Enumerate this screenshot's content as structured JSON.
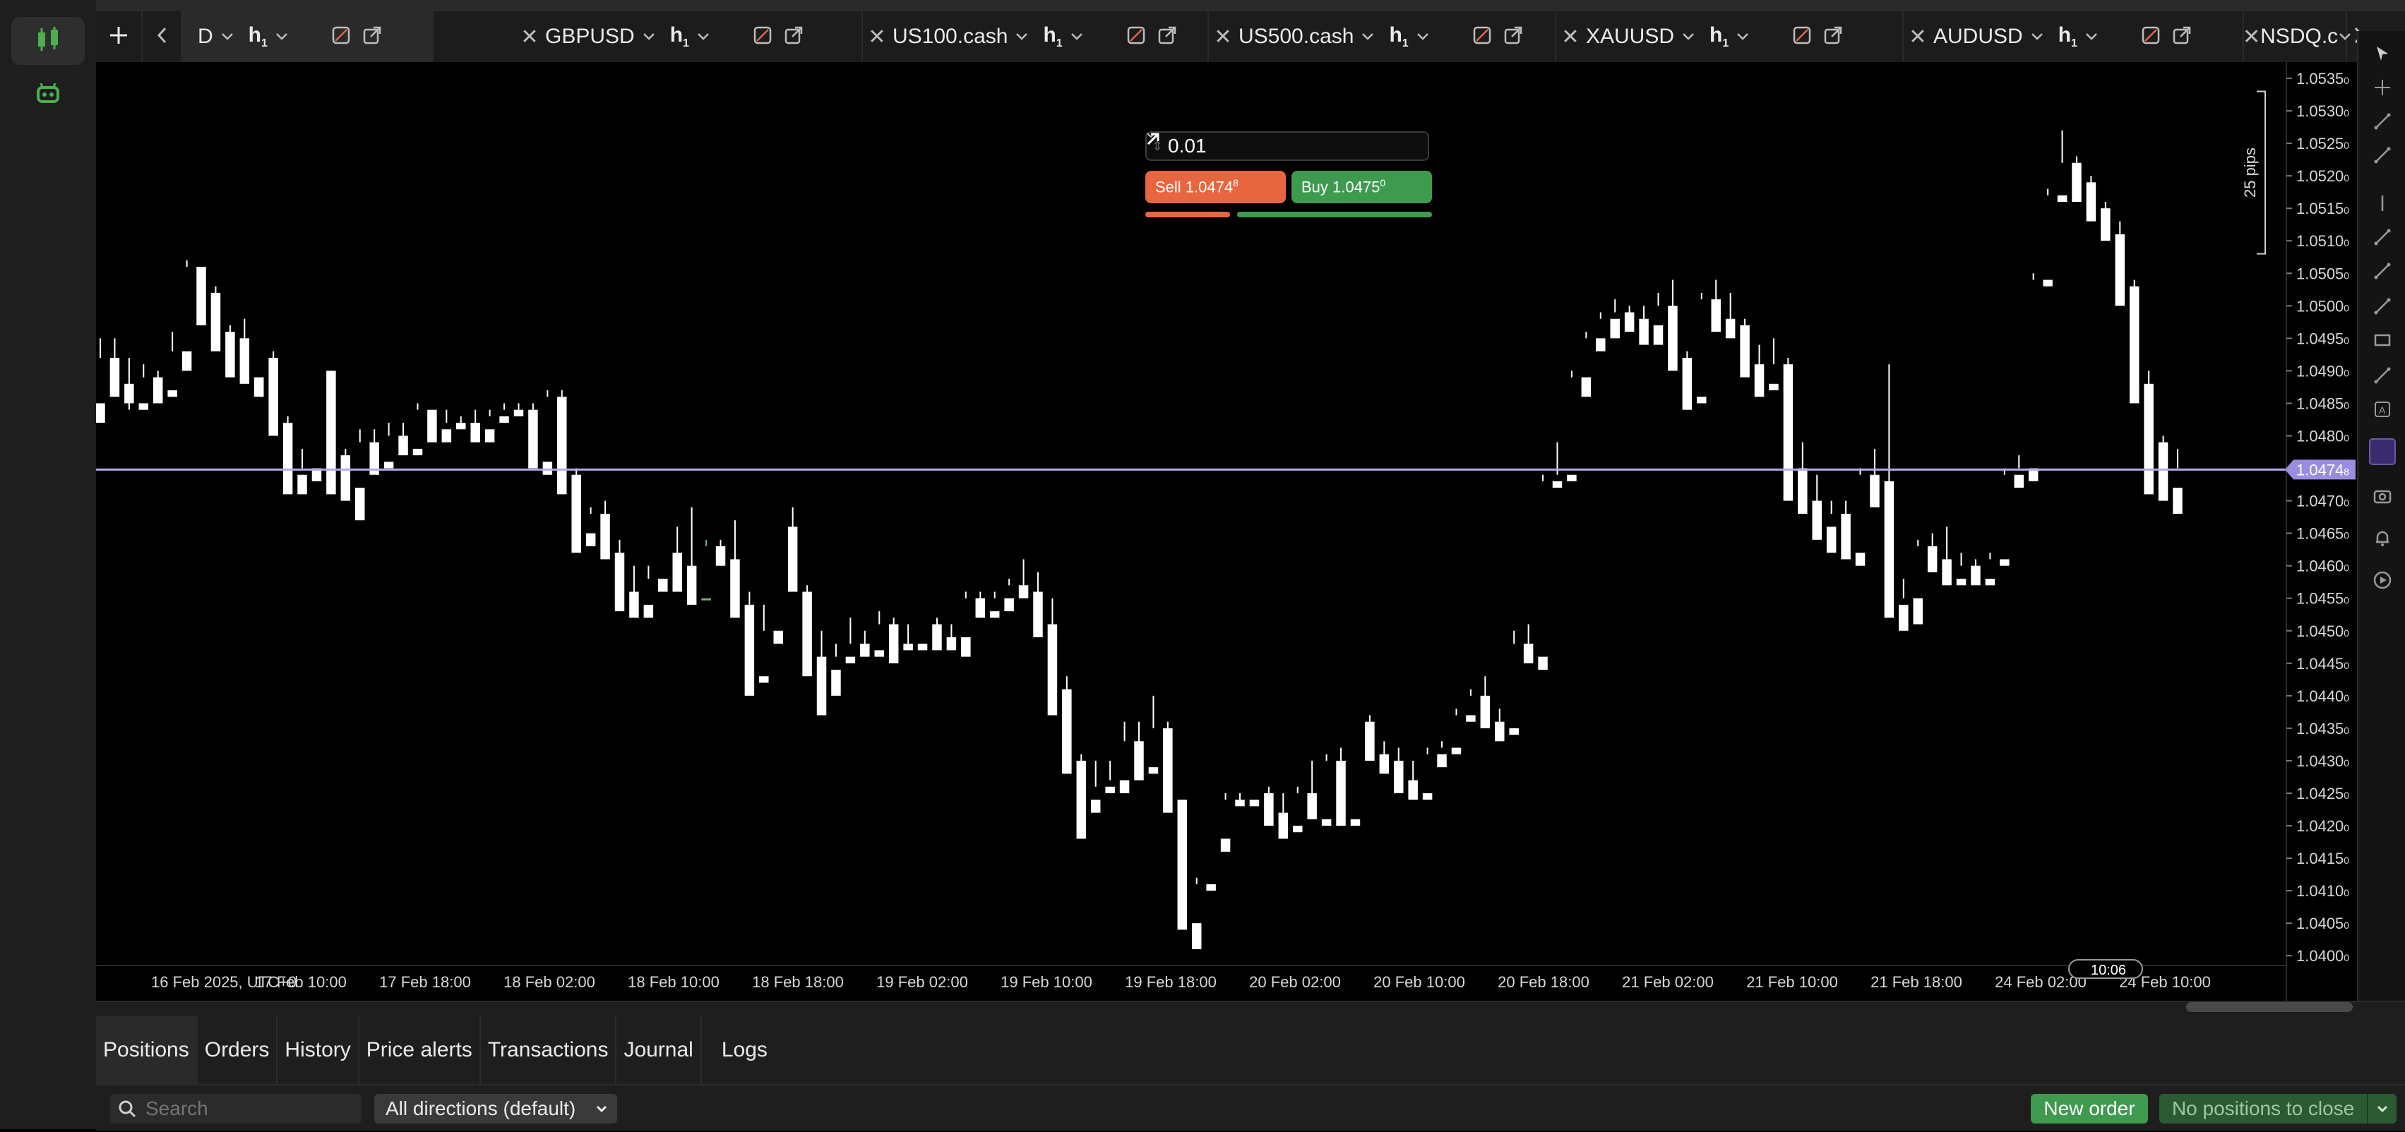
{
  "tabs": [
    {
      "symbol": "D",
      "timeframe": "h",
      "timeframe_sub": "1",
      "active": true
    },
    {
      "symbol": "GBPUSD",
      "timeframe": "h",
      "timeframe_sub": "1"
    },
    {
      "symbol": "US100.cash",
      "timeframe": "h",
      "timeframe_sub": "1"
    },
    {
      "symbol": "US500.cash",
      "timeframe": "h",
      "timeframe_sub": "1"
    },
    {
      "symbol": "XAUUSD",
      "timeframe": "h",
      "timeframe_sub": "1"
    },
    {
      "symbol": "AUDUSD",
      "timeframe": "h",
      "timeframe_sub": "1"
    },
    {
      "symbol": "NSDQ.c",
      "timeframe": "h",
      "timeframe_sub": "1"
    }
  ],
  "trade": {
    "lot": "0.01",
    "sell_label": "Sell 1.0474",
    "sell_small": "8",
    "buy_label": "Buy 1.0475",
    "buy_small": "0"
  },
  "chart_data": {
    "type": "candlestick",
    "x_ticks": [
      "16 Feb 2025, UTC+0",
      "17 Feb 10:00",
      "17 Feb 18:00",
      "18 Feb 02:00",
      "18 Feb 10:00",
      "18 Feb 18:00",
      "19 Feb 02:00",
      "19 Feb 10:00",
      "19 Feb 18:00",
      "20 Feb 02:00",
      "20 Feb 10:00",
      "20 Feb 18:00",
      "21 Feb 02:00",
      "21 Feb 10:00",
      "21 Feb 18:00",
      "24 Feb 02:00",
      "24 Feb 10:00"
    ],
    "y_ticks": [
      "1.0535",
      "1.0530",
      "1.0525",
      "1.0520",
      "1.0515",
      "1.0510",
      "1.0505",
      "1.0500",
      "1.0495",
      "1.0490",
      "1.0485",
      "1.0480",
      "1.0475",
      "1.0470",
      "1.0465",
      "1.0460",
      "1.0455",
      "1.0450",
      "1.0445",
      "1.0440",
      "1.0435",
      "1.0430",
      "1.0425",
      "1.0420",
      "1.0415",
      "1.0410",
      "1.0405",
      "1.0400"
    ],
    "y_tick_suffix": "0",
    "ylim": [
      1.03985,
      1.05375
    ],
    "current_price": "1.0474",
    "current_price_suffix": "8",
    "current_price_value": 1.04748,
    "crosshair_time": "10:06",
    "ruler_label": "25 pips",
    "ruler_range": [
      1.0508,
      1.0533
    ],
    "colors": {
      "up": "#6fb07c",
      "down": "#ffffff",
      "price_line": "#b7a9e6",
      "price_tag": "#9b8ce0"
    },
    "ohlc": [
      [
        1.0485,
        1.0495,
        1.0492,
        1.0482
      ],
      [
        1.0492,
        1.0495,
        1.0488,
        1.0486
      ],
      [
        1.0488,
        1.0492,
        1.0484,
        1.0485
      ],
      [
        1.0485,
        1.0491,
        1.0489,
        1.0484
      ],
      [
        1.0489,
        1.049,
        1.0487,
        1.0485
      ],
      [
        1.0487,
        1.0496,
        1.0493,
        1.0486
      ],
      [
        1.0493,
        1.0507,
        1.0506,
        1.049
      ],
      [
        1.0506,
        1.0506,
        1.0502,
        1.0497
      ],
      [
        1.0502,
        1.0503,
        1.0496,
        1.0493
      ],
      [
        1.0496,
        1.0497,
        1.0495,
        1.0489
      ],
      [
        1.0495,
        1.0498,
        1.0489,
        1.0488
      ],
      [
        1.0489,
        1.0492,
        1.0492,
        1.0486
      ],
      [
        1.0492,
        1.0493,
        1.0482,
        1.048
      ],
      [
        1.0482,
        1.0483,
        1.0474,
        1.0471
      ],
      [
        1.0474,
        1.0478,
        1.0475,
        1.0471
      ],
      [
        1.0475,
        1.049,
        1.049,
        1.0473
      ],
      [
        1.049,
        1.049,
        1.0477,
        1.0471
      ],
      [
        1.0477,
        1.0478,
        1.0472,
        1.047
      ],
      [
        1.0472,
        1.0481,
        1.0479,
        1.0467
      ],
      [
        1.0479,
        1.0481,
        1.0476,
        1.0474
      ],
      [
        1.0476,
        1.0482,
        1.048,
        1.0475
      ],
      [
        1.048,
        1.0482,
        1.0478,
        1.0477
      ],
      [
        1.0478,
        1.0485,
        1.0484,
        1.0477
      ],
      [
        1.0484,
        1.0484,
        1.0481,
        1.0479
      ],
      [
        1.0481,
        1.0484,
        1.0482,
        1.0479
      ],
      [
        1.0482,
        1.0483,
        1.0482,
        1.0481
      ],
      [
        1.0482,
        1.0484,
        1.0481,
        1.0479
      ],
      [
        1.0481,
        1.0484,
        1.0483,
        1.0479
      ],
      [
        1.0483,
        1.0485,
        1.0484,
        1.0482
      ],
      [
        1.0484,
        1.0485,
        1.0484,
        1.0483
      ],
      [
        1.0484,
        1.0485,
        1.0476,
        1.0475
      ],
      [
        1.0476,
        1.0487,
        1.0486,
        1.0474
      ],
      [
        1.0486,
        1.0487,
        1.0474,
        1.0471
      ],
      [
        1.0474,
        1.0475,
        1.0465,
        1.0462
      ],
      [
        1.0465,
        1.0469,
        1.0468,
        1.0463
      ],
      [
        1.0468,
        1.047,
        1.0462,
        1.0461
      ],
      [
        1.0462,
        1.0464,
        1.0456,
        1.0453
      ],
      [
        1.0456,
        1.046,
        1.0454,
        1.0452
      ],
      [
        1.0454,
        1.046,
        1.0458,
        1.0452
      ],
      [
        1.0458,
        1.0462,
        1.0462,
        1.0456
      ],
      [
        1.0462,
        1.0466,
        1.046,
        1.0456
      ],
      [
        1.046,
        1.0469,
        1.0455,
        1.0454
      ],
      [
        1.0455,
        1.0464,
        1.0463,
        1.0455
      ],
      [
        1.0463,
        1.0464,
        1.0461,
        1.046
      ],
      [
        1.0461,
        1.0467,
        1.0454,
        1.0452
      ],
      [
        1.0454,
        1.0456,
        1.0443,
        1.044
      ],
      [
        1.0443,
        1.0454,
        1.045,
        1.0442
      ],
      [
        1.045,
        1.0466,
        1.0466,
        1.0448
      ],
      [
        1.0466,
        1.0469,
        1.0456,
        1.0456
      ],
      [
        1.0456,
        1.0457,
        1.0446,
        1.0443
      ],
      [
        1.0446,
        1.045,
        1.0444,
        1.0437
      ],
      [
        1.0444,
        1.0448,
        1.0446,
        1.044
      ],
      [
        1.0446,
        1.0452,
        1.0448,
        1.0445
      ],
      [
        1.0448,
        1.045,
        1.0447,
        1.0446
      ],
      [
        1.0447,
        1.0453,
        1.0451,
        1.0446
      ],
      [
        1.0451,
        1.0452,
        1.0448,
        1.0445
      ],
      [
        1.0448,
        1.0451,
        1.0448,
        1.0447
      ],
      [
        1.0448,
        1.0451,
        1.0451,
        1.0447
      ],
      [
        1.0451,
        1.0452,
        1.0449,
        1.0447
      ],
      [
        1.0449,
        1.0451,
        1.0449,
        1.0447
      ],
      [
        1.0449,
        1.0456,
        1.0455,
        1.0446
      ],
      [
        1.0455,
        1.0456,
        1.0453,
        1.0452
      ],
      [
        1.0453,
        1.0456,
        1.0455,
        1.0452
      ],
      [
        1.0455,
        1.0458,
        1.0457,
        1.0453
      ],
      [
        1.0457,
        1.0461,
        1.0456,
        1.0455
      ],
      [
        1.0456,
        1.0459,
        1.0451,
        1.0449
      ],
      [
        1.0451,
        1.0455,
        1.0441,
        1.0437
      ],
      [
        1.0441,
        1.0443,
        1.043,
        1.0428
      ],
      [
        1.043,
        1.0431,
        1.0424,
        1.0418
      ],
      [
        1.0424,
        1.043,
        1.0426,
        1.0422
      ],
      [
        1.0426,
        1.043,
        1.0427,
        1.0425
      ],
      [
        1.0427,
        1.0436,
        1.0433,
        1.0425
      ],
      [
        1.0433,
        1.0436,
        1.0429,
        1.0427
      ],
      [
        1.0429,
        1.044,
        1.0435,
        1.0428
      ],
      [
        1.0435,
        1.0436,
        1.0424,
        1.0422
      ],
      [
        1.0424,
        1.0424,
        1.0405,
        1.0404
      ],
      [
        1.0405,
        1.0412,
        1.0411,
        1.0401
      ],
      [
        1.0411,
        1.0418,
        1.0418,
        1.041
      ],
      [
        1.0418,
        1.0425,
        1.0424,
        1.0416
      ],
      [
        1.0424,
        1.0425,
        1.0424,
        1.0423
      ],
      [
        1.0424,
        1.0425,
        1.0425,
        1.0423
      ],
      [
        1.0425,
        1.0426,
        1.0422,
        1.042
      ],
      [
        1.0422,
        1.0425,
        1.042,
        1.0418
      ],
      [
        1.042,
        1.0426,
        1.0425,
        1.0419
      ],
      [
        1.0425,
        1.043,
        1.0421,
        1.0421
      ],
      [
        1.0421,
        1.0431,
        1.043,
        1.042
      ],
      [
        1.043,
        1.0432,
        1.0421,
        1.042
      ],
      [
        1.0421,
        1.0436,
        1.0436,
        1.042
      ],
      [
        1.0436,
        1.0437,
        1.0431,
        1.043
      ],
      [
        1.0431,
        1.0433,
        1.043,
        1.0428
      ],
      [
        1.043,
        1.0432,
        1.0427,
        1.0425
      ],
      [
        1.0427,
        1.043,
        1.0425,
        1.0424
      ],
      [
        1.0425,
        1.0432,
        1.0431,
        1.0424
      ],
      [
        1.0431,
        1.0433,
        1.0432,
        1.0429
      ],
      [
        1.0432,
        1.0438,
        1.0437,
        1.0431
      ],
      [
        1.0437,
        1.0441,
        1.044,
        1.0436
      ],
      [
        1.044,
        1.0443,
        1.0436,
        1.0435
      ],
      [
        1.0436,
        1.0438,
        1.0435,
        1.0433
      ],
      [
        1.0435,
        1.045,
        1.0448,
        1.0434
      ],
      [
        1.0448,
        1.0451,
        1.0446,
        1.0445
      ],
      [
        1.0446,
        1.0474,
        1.0473,
        1.0444
      ],
      [
        1.0473,
        1.0479,
        1.0474,
        1.0472
      ],
      [
        1.0474,
        1.049,
        1.0489,
        1.0473
      ],
      [
        1.0489,
        1.0496,
        1.0495,
        1.0486
      ],
      [
        1.0495,
        1.0499,
        1.0498,
        1.0493
      ],
      [
        1.0498,
        1.0501,
        1.0499,
        1.0495
      ],
      [
        1.0499,
        1.05,
        1.0498,
        1.0496
      ],
      [
        1.0498,
        1.05,
        1.0497,
        1.0494
      ],
      [
        1.0497,
        1.0502,
        1.05,
        1.0494
      ],
      [
        1.05,
        1.0504,
        1.0492,
        1.049
      ],
      [
        1.0492,
        1.0493,
        1.0486,
        1.0484
      ],
      [
        1.0486,
        1.0502,
        1.0501,
        1.0485
      ],
      [
        1.0501,
        1.0504,
        1.0498,
        1.0496
      ],
      [
        1.0498,
        1.0502,
        1.0497,
        1.0495
      ],
      [
        1.0497,
        1.0498,
        1.0491,
        1.0489
      ],
      [
        1.0491,
        1.0494,
        1.0488,
        1.0486
      ],
      [
        1.0488,
        1.0495,
        1.0491,
        1.0487
      ],
      [
        1.0491,
        1.0492,
        1.0475,
        1.047
      ],
      [
        1.0475,
        1.0479,
        1.047,
        1.0468
      ],
      [
        1.047,
        1.0474,
        1.0466,
        1.0464
      ],
      [
        1.0466,
        1.047,
        1.0468,
        1.0462
      ],
      [
        1.0468,
        1.047,
        1.0462,
        1.0461
      ],
      [
        1.0462,
        1.0475,
        1.0474,
        1.046
      ],
      [
        1.0474,
        1.0478,
        1.0473,
        1.0469
      ],
      [
        1.0473,
        1.0491,
        1.0454,
        1.0452
      ],
      [
        1.0454,
        1.0458,
        1.0455,
        1.045
      ],
      [
        1.0455,
        1.0464,
        1.0463,
        1.0451
      ],
      [
        1.0463,
        1.0465,
        1.0461,
        1.0459
      ],
      [
        1.0461,
        1.0466,
        1.0458,
        1.0457
      ],
      [
        1.0458,
        1.0462,
        1.046,
        1.0457
      ],
      [
        1.046,
        1.0461,
        1.0458,
        1.0457
      ],
      [
        1.0458,
        1.0462,
        1.0461,
        1.0457
      ],
      [
        1.0461,
        1.0475,
        1.0474,
        1.046
      ],
      [
        1.0474,
        1.0477,
        1.0475,
        1.0472
      ],
      [
        1.0475,
        1.0505,
        1.0504,
        1.0473
      ],
      [
        1.0504,
        1.0518,
        1.0517,
        1.0503
      ],
      [
        1.0517,
        1.0527,
        1.0522,
        1.0516
      ],
      [
        1.0522,
        1.0523,
        1.0519,
        1.0516
      ],
      [
        1.0519,
        1.052,
        1.0515,
        1.0513
      ],
      [
        1.0515,
        1.0516,
        1.0511,
        1.051
      ],
      [
        1.0511,
        1.0513,
        1.0503,
        1.05
      ],
      [
        1.0503,
        1.0504,
        1.0488,
        1.0485
      ],
      [
        1.0488,
        1.049,
        1.0479,
        1.0471
      ],
      [
        1.0479,
        1.048,
        1.0472,
        1.047
      ],
      [
        1.0472,
        1.0478,
        1.0475,
        1.0468
      ]
    ]
  },
  "bottom_panel": {
    "tabs": [
      "Positions",
      "Orders",
      "History",
      "Price alerts",
      "Transactions",
      "Journal",
      "Logs"
    ],
    "search_placeholder": "Search",
    "direction_filter": "All directions (default)",
    "new_order": "New order",
    "close_all": "No positions to close"
  }
}
